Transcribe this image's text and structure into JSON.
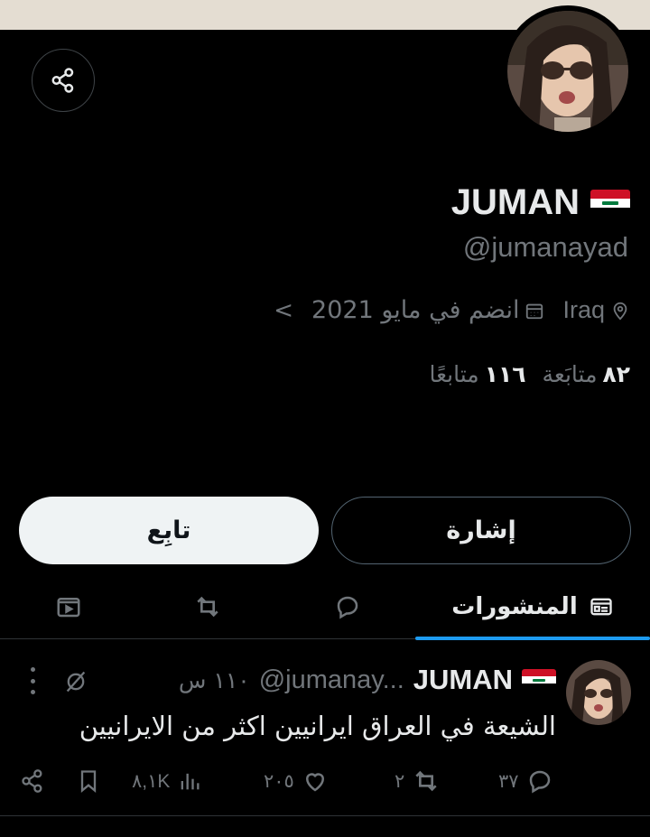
{
  "profile": {
    "name": "JUMAN",
    "handle": "@jumanayad",
    "location": "Iraq",
    "joined": "انضم في مايو 2021",
    "following_count": "٨٢",
    "following_label": "متابَعة",
    "followers_count": "١١٦",
    "followers_label": "متابعًا"
  },
  "buttons": {
    "follow": "تابِع",
    "mention": "إشارة"
  },
  "tabs": {
    "posts": "المنشورات"
  },
  "tweet": {
    "name": "JUMAN",
    "handle": "@jumanay...",
    "time": "١١٠ س",
    "text": "الشيعة في العراق ايرانيين اكثر من الايرانيين",
    "replies": "٣٧",
    "reposts": "٢",
    "likes": "٢٠٥",
    "views": "٨,١K"
  },
  "colors": {
    "background": "#000000",
    "accent": "#1d9bf0",
    "muted": "#71767b",
    "follow_button": "#eff3f4"
  },
  "icons": [
    "share-icon",
    "location-icon",
    "calendar-icon",
    "chevron-left-icon",
    "posts-tab-icon",
    "reply-icon",
    "repost-icon",
    "video-icon",
    "more-icon",
    "grok-icon",
    "views-icon",
    "bookmark-icon",
    "like-icon"
  ]
}
